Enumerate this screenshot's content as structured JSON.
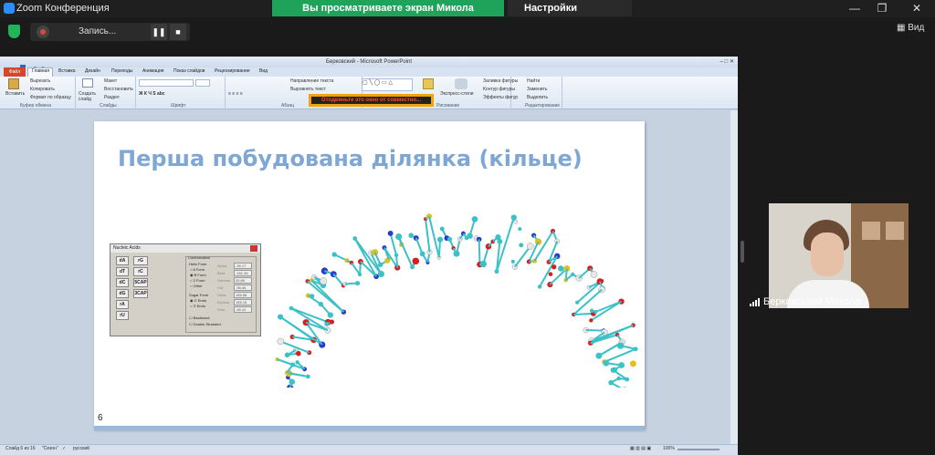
{
  "zoom": {
    "title": "Zoom Конференция",
    "share_banner": "Вы просматриваете экран Микола Берковський",
    "view_options": "Настройки просмотра",
    "recording_label": "Запись...",
    "view_button": "Вид",
    "participant_name": "Берковський Микола",
    "colors": {
      "banner": "#1fa25a",
      "shield": "#23b45a"
    }
  },
  "ppt": {
    "window_title": "Берковский - Microsoft PowerPoint",
    "tabs": [
      "Файл",
      "Главная",
      "Вставка",
      "Дизайн",
      "Переходы",
      "Анимация",
      "Показ слайдов",
      "Рецензирование",
      "Вид"
    ],
    "groups": [
      "Буфер обмена",
      "Слайды",
      "Шрифт",
      "Абзац",
      "Рисование",
      "Редактирование"
    ],
    "clipboard": {
      "paste": "Вставить",
      "cut": "Вырезать",
      "copy": "Копировать",
      "format": "Формат по образцу"
    },
    "slides": {
      "create": "Создать слайд",
      "layout": "Макет",
      "restore": "Восстановить",
      "section": "Раздел"
    },
    "paragraph": {
      "text_dir": "Направление текста",
      "align": "Выровнять текст",
      "convert": "Преобразовать в SmartArt"
    },
    "drawing": {
      "express": "Экспресс-стили",
      "fill": "Заливка фигуры",
      "outline": "Контур фигуры",
      "effects": "Эффекты фигур"
    },
    "editing": {
      "find": "Найти",
      "replace": "Заменить",
      "select": "Выделить"
    },
    "warning": "Отодвиньте это окно от совместно...",
    "status": {
      "slide": "Слайд 6 из 16",
      "theme": "\"Сезон\"",
      "lang": "русский",
      "zoom": "100%"
    }
  },
  "slide": {
    "title": "Перша побудована ділянка (кільце)",
    "number": "6"
  },
  "nucleic_acids": {
    "title": "Nucleic Acids",
    "buttons_left": [
      "dA",
      "dT",
      "dC",
      "dG",
      "rA",
      "rU"
    ],
    "buttons_right": [
      "rG",
      "rC",
      "5CAP",
      "3CAP"
    ],
    "conformation_label": "Conformation",
    "helix_form_label": "Helix Form",
    "helix_forms": [
      "A Form",
      "B Form",
      "Z Form",
      "Other"
    ],
    "sugar_form_label": "Sugar Form",
    "sugar_forms": [
      "2' Endo",
      "3' Endo"
    ],
    "backbond": "Backbond",
    "double_stranded": "Double Stranded",
    "params": [
      {
        "name": "Alpha",
        "value": "-39.17"
      },
      {
        "name": "Beta",
        "value": "-151.46"
      },
      {
        "name": "Gamma",
        "value": "30.89"
      },
      {
        "name": "Chi",
        "value": "-98.46"
      },
      {
        "name": "Delta",
        "value": "156.56"
      },
      {
        "name": "Epsilon",
        "value": "155.18"
      },
      {
        "name": "Zeta",
        "value": "-95.10"
      }
    ]
  }
}
